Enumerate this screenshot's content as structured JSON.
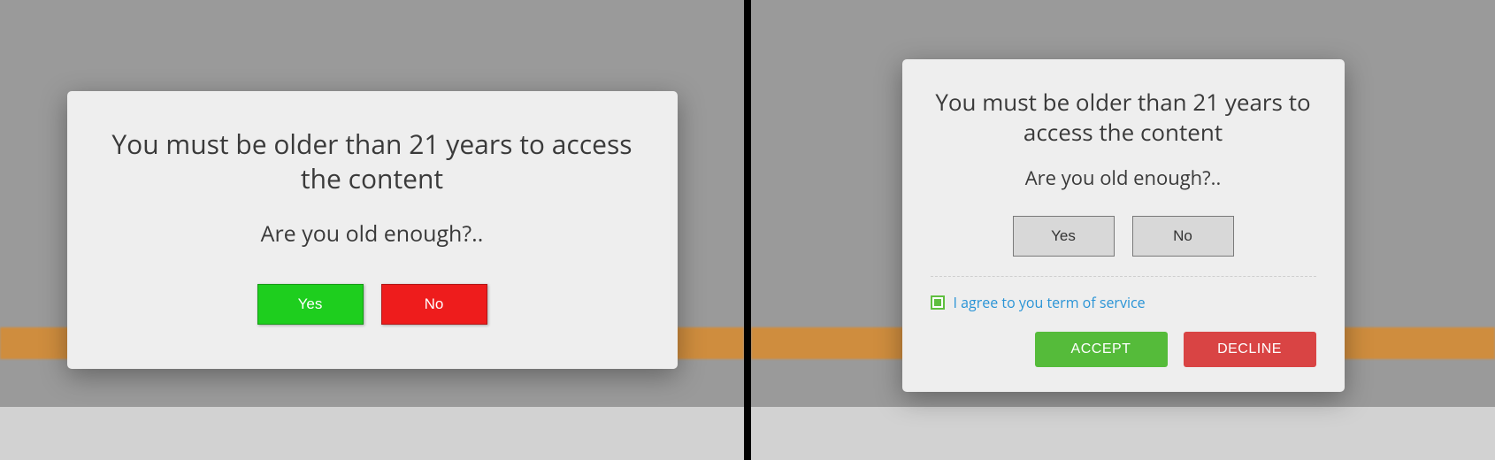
{
  "left": {
    "title": "You must be older than 21 years to access the content",
    "question": "Are you old enough?..",
    "yes_label": "Yes",
    "no_label": "No"
  },
  "right": {
    "title": "You must be older than 21 years to access the content",
    "question": "Are you old enough?..",
    "yes_label": "Yes",
    "no_label": "No",
    "terms_label": "I agree to you term of service",
    "accept_label": "ACCEPT",
    "decline_label": "DECLINE"
  }
}
